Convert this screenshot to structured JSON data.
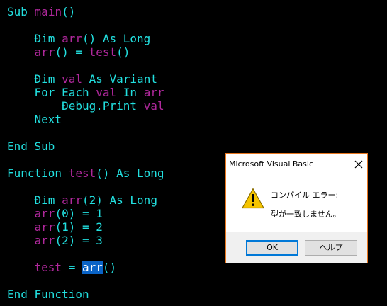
{
  "editor": {
    "sub_main": {
      "kw": "Sub",
      "name": "main",
      "rest": "()"
    },
    "dim_arr": {
      "kw1": "Đim",
      "id": "arr",
      "rest": "() As Long"
    },
    "assign_arr": {
      "id1": "arr",
      "mid": "() = ",
      "id2": "test",
      "rest": "()"
    },
    "dim_val": {
      "kw1": "Đim",
      "id": "val",
      "rest": "As Variant"
    },
    "for_each": {
      "kw1": "For Each",
      "id1": "val",
      "kw2": "In",
      "id2": "arr"
    },
    "debug_print": {
      "kw": "Đebug.Print",
      "id": "val"
    },
    "next": {
      "kw": "Next"
    },
    "end_sub": {
      "kw": "End Sub"
    },
    "func_test": {
      "kw1": "Function",
      "id": "test",
      "rest": "() As Long"
    },
    "dim_arr2": {
      "kw1": "Đim",
      "id": "arr",
      "rest": "(2) As Long"
    },
    "arr0": {
      "id": "arr",
      "rest": "(0) = 1"
    },
    "arr1": {
      "id": "arr",
      "rest": "(1) = 2"
    },
    "arr2": {
      "id": "arr",
      "rest": "(2) = 3"
    },
    "test_ret": {
      "id": "test",
      "mid": " = ",
      "sel": "arr",
      "rest": "()"
    },
    "end_func": {
      "kw": "End Function"
    }
  },
  "dialog": {
    "title": "Microsoft Visual Basic",
    "close_glyph": "✕",
    "icon": "warning-icon",
    "message_heading": "コンパイル エラー:",
    "message_detail": "型が一致しません。",
    "ok_label": "OK",
    "help_label": "ヘルプ"
  },
  "colors": {
    "keyword": "#22e0e0",
    "identifier": "#b0289c",
    "selection": "#0a63c6",
    "background": "#000000",
    "dialog_border": "#e8761e"
  }
}
